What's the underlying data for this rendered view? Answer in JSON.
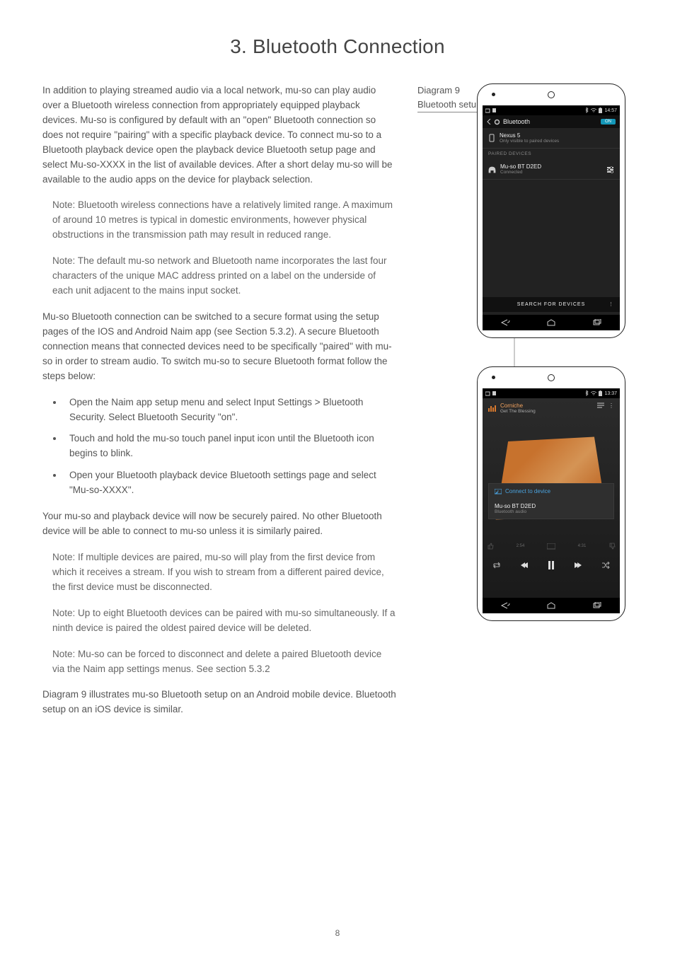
{
  "title": "3. Bluetooth Connection",
  "page_number": "8",
  "left": {
    "p1": "In addition to playing streamed audio via a local network, mu-so can play audio over a Bluetooth wireless connection from appropriately equipped playback devices. Mu-so is configured by default with an \"open\" Bluetooth connection so does not require \"pairing\" with a specific playback device. To connect mu-so to a Bluetooth playback device open the playback device Bluetooth setup page and select Mu-so-XXXX in the list of available devices. After a short delay mu-so will be available to the audio apps on the device for playback selection.",
    "note1": "Note: Bluetooth wireless connections have a relatively limited range. A maximum of around 10 metres is typical in domestic environments, however physical obstructions in the transmission path may result in reduced range.",
    "note2": "Note: The default mu-so network and Bluetooth name incorporates the last four characters of the unique MAC address printed on a label on the underside of each unit adjacent to the mains input socket.",
    "p2": "Mu-so Bluetooth connection can be switched to a secure format using the setup pages of the IOS and Android Naim app (see Section 5.3.2). A secure Bluetooth connection means that connected devices need to be specifically \"paired\" with mu-so in order to stream audio. To switch mu-so to secure Bluetooth format follow the steps below:",
    "step1": "Open the Naim app setup menu and select Input Settings > Bluetooth Security. Select Bluetooth Security \"on\".",
    "step2": "Touch and hold the mu-so touch panel input icon until the Bluetooth icon begins to blink.",
    "step3": "Open your Bluetooth playback device Bluetooth settings page and select \"Mu-so-XXXX\".",
    "p3": "Your mu-so and playback device will now be securely paired. No other Bluetooth device will be able to connect to mu-so unless it is similarly paired.",
    "note3": "Note: If multiple devices are paired, mu-so will play from the first device from which it receives a stream. If you wish to stream from a different paired device, the first device must be disconnected.",
    "note4": "Note: Up to eight Bluetooth devices can be paired with mu-so simultaneously. If a ninth device is paired the oldest paired device will be deleted.",
    "note5": "Note: Mu-so can be forced to disconnect and delete a paired Bluetooth device via the Naim app settings menus. See section 5.3.2",
    "p4": "Diagram 9 illustrates mu-so Bluetooth setup on an Android mobile device. Bluetooth setup on an iOS device is similar."
  },
  "diagram": {
    "label_line1": "Diagram 9",
    "label_line2": "Bluetooth setup"
  },
  "phone1": {
    "time": "14:57",
    "header": "Bluetooth",
    "toggle": "ON",
    "device_name": "Nexus 5",
    "device_sub": "Only visible to paired devices",
    "section": "PAIRED DEVICES",
    "paired_name": "Mu-so BT D2ED",
    "paired_sub": "Connected",
    "search": "SEARCH FOR DEVICES"
  },
  "phone2": {
    "time": "13:37",
    "track": "Corniche",
    "artist": "Get The Blessing",
    "connect_hdr": "Connect to device",
    "dev_name": "Mu-so BT D2ED",
    "dev_sub": "Bluetooth audio",
    "elapsed": "2:54",
    "total": "4:31"
  }
}
